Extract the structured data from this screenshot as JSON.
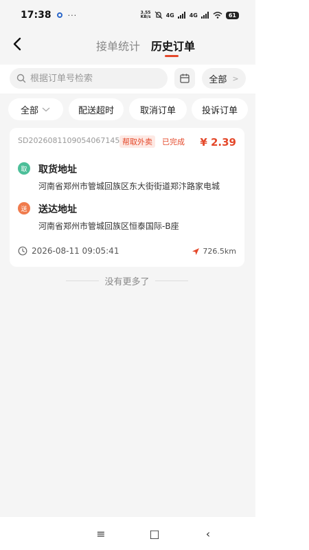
{
  "status_bar": {
    "time": "17:38",
    "more": "···",
    "net_speed_value": "3.55",
    "net_speed_unit": "KB/s",
    "signal1": "4G",
    "signal2": "4G",
    "battery": "61"
  },
  "header": {
    "tabs": [
      {
        "label": "接单统计",
        "active": false
      },
      {
        "label": "历史订单",
        "active": true
      }
    ],
    "accent_color": "#e4482a"
  },
  "search": {
    "placeholder": "根据订单号检索",
    "value": "",
    "scope_label": "全部"
  },
  "filters": [
    {
      "label": "全部"
    },
    {
      "label": "配送超时"
    },
    {
      "label": "取消订单"
    },
    {
      "label": "投诉订单"
    }
  ],
  "order": {
    "order_no": "SD2026081109054067145",
    "type_tag": "帮取外卖",
    "status": "已完成",
    "price": "¥ 2.39",
    "pickup": {
      "badge": "取",
      "title": "取货地址",
      "address": "河南省郑州市管城回族区东大街街道郑汴路家电城"
    },
    "delivery": {
      "badge": "送",
      "title": "送达地址",
      "address": "河南省郑州市管城回族区恒泰国际-B座"
    },
    "time": "2026-08-11 09:05:41",
    "distance": "726.5km"
  },
  "list_end": "没有更多了",
  "nav": {
    "menu_icon": "≡",
    "home_icon": "□",
    "back_icon": "‹"
  }
}
